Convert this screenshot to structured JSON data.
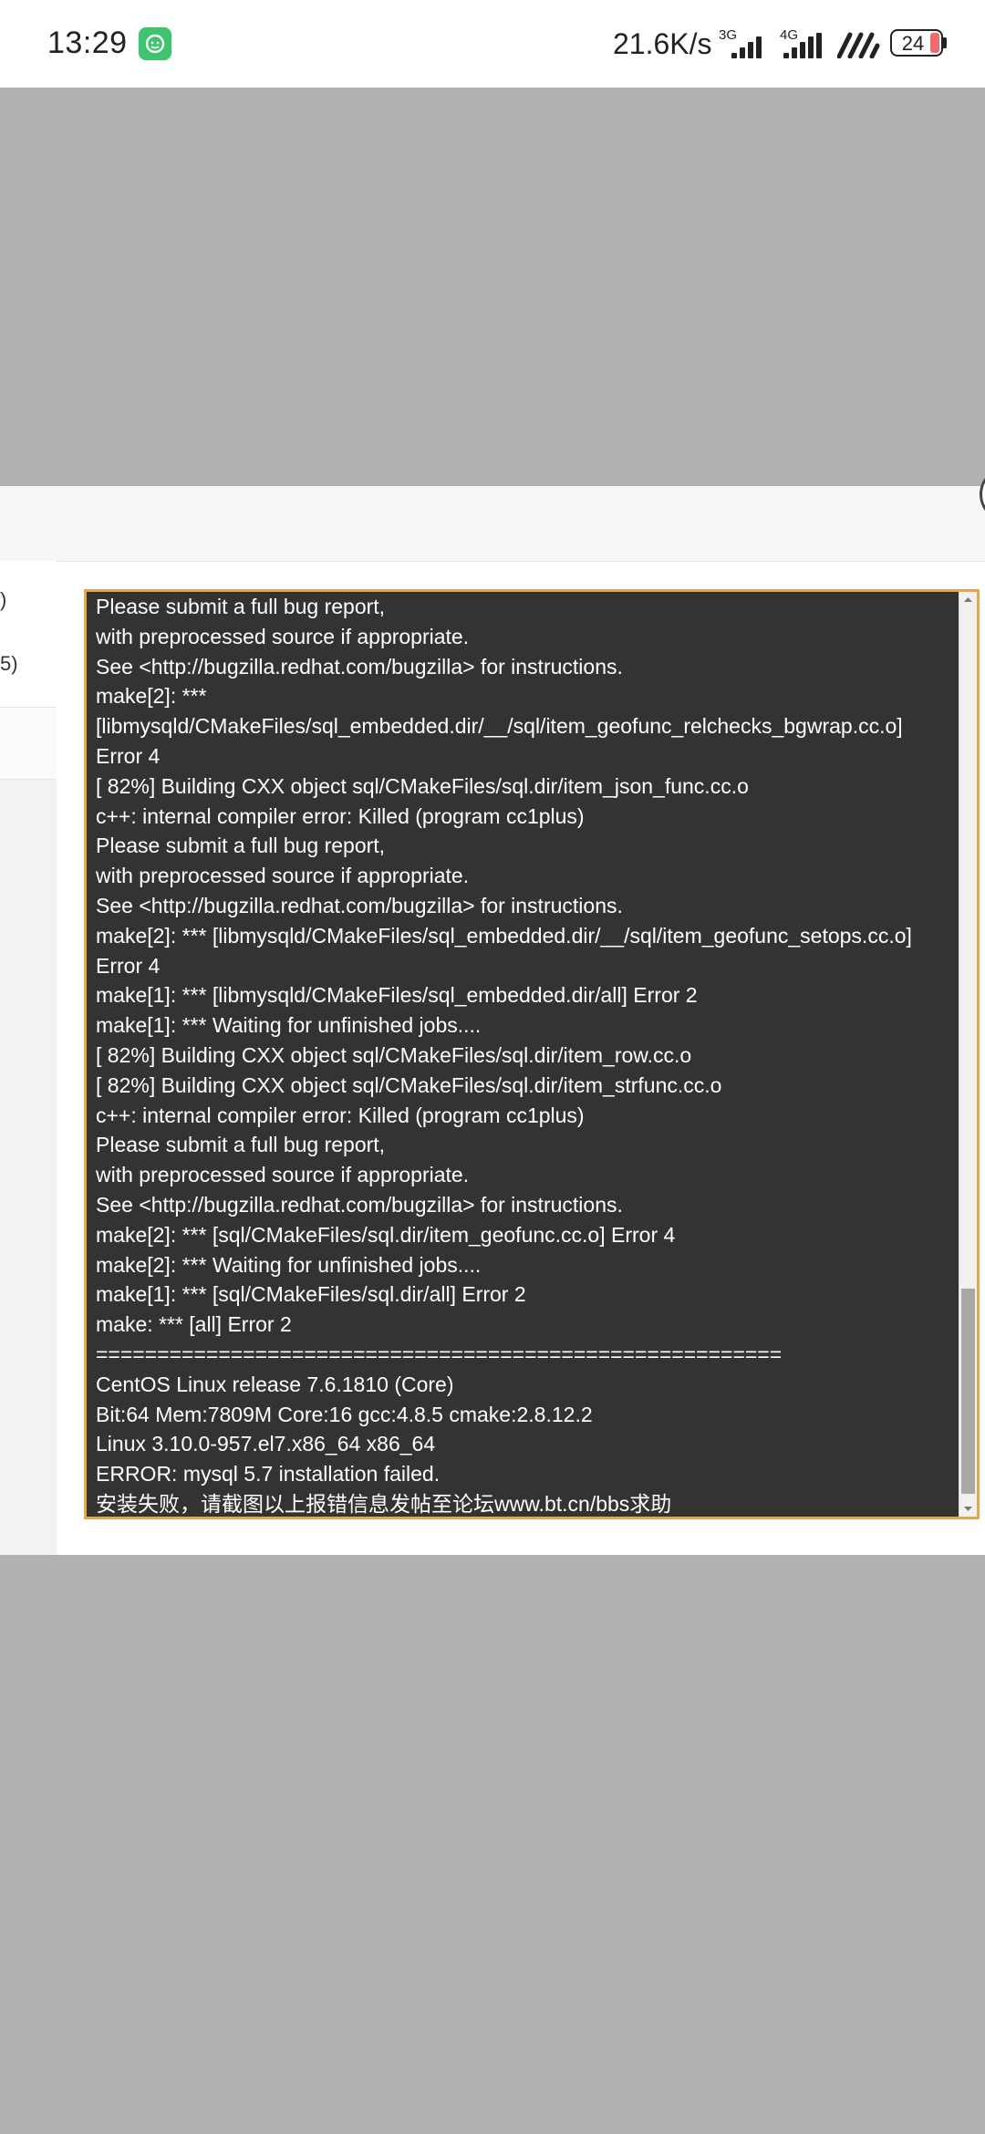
{
  "status_bar": {
    "time": "13:29",
    "net_speed": "21.6K/s",
    "sim1": "3G",
    "sim2": "4G",
    "battery": "24"
  },
  "side_fragments": [
    ")",
    "5)"
  ],
  "console": {
    "lines": [
      "Please submit a full bug report,",
      "with preprocessed source if appropriate.",
      "See <http://bugzilla.redhat.com/bugzilla> for instructions.",
      "make[2]: ***",
      "[libmysqld/CMakeFiles/sql_embedded.dir/__/sql/item_geofunc_relchecks_bgwrap.cc.o]",
      "Error 4",
      "[ 82%] Building CXX object sql/CMakeFiles/sql.dir/item_json_func.cc.o",
      "c++: internal compiler error: Killed (program cc1plus)",
      "Please submit a full bug report,",
      "with preprocessed source if appropriate.",
      "See <http://bugzilla.redhat.com/bugzilla> for instructions.",
      "make[2]: *** [libmysqld/CMakeFiles/sql_embedded.dir/__/sql/item_geofunc_setops.cc.o]",
      "Error 4",
      "make[1]: *** [libmysqld/CMakeFiles/sql_embedded.dir/all] Error 2",
      "make[1]: *** Waiting for unfinished jobs....",
      "[ 82%] Building CXX object sql/CMakeFiles/sql.dir/item_row.cc.o",
      "[ 82%] Building CXX object sql/CMakeFiles/sql.dir/item_strfunc.cc.o",
      "c++: internal compiler error: Killed (program cc1plus)",
      "Please submit a full bug report,",
      "with preprocessed source if appropriate.",
      "See <http://bugzilla.redhat.com/bugzilla> for instructions.",
      "make[2]: *** [sql/CMakeFiles/sql.dir/item_geofunc.cc.o] Error 4",
      "make[2]: *** Waiting for unfinished jobs....",
      "make[1]: *** [sql/CMakeFiles/sql.dir/all] Error 2",
      "make: *** [all] Error 2",
      "========================================================",
      "CentOS Linux release 7.6.1810 (Core)",
      "Bit:64 Mem:7809M Core:16 gcc:4.8.5 cmake:2.8.12.2",
      "Linux 3.10.0-957.el7.x86_64 x86_64",
      "ERROR: mysql 5.7 installation failed.",
      "安装失败，请截图以上报错信息发帖至论坛www.bt.cn/bbs求助"
    ]
  }
}
